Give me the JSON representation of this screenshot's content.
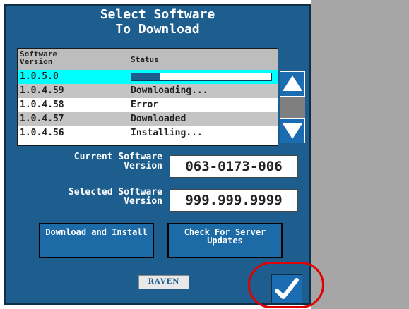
{
  "dialog": {
    "title_line1": "Select Software",
    "title_line2": "To Download"
  },
  "table": {
    "header_version": "Software Version",
    "header_status": "Status",
    "rows": [
      {
        "version": "1.0.5.0",
        "status": "",
        "progress": 0.2,
        "selected": true
      },
      {
        "version": "1.0.4.59",
        "status": "Downloading..."
      },
      {
        "version": "1.0.4.58",
        "status": "Error"
      },
      {
        "version": "1.0.4.57",
        "status": "Downloaded"
      },
      {
        "version": "1.0.4.56",
        "status": "Installing..."
      }
    ]
  },
  "current": {
    "label": "Current Software Version",
    "value": "063-0173-006"
  },
  "selected": {
    "label": "Selected Software Version",
    "value": "999.999.9999"
  },
  "buttons": {
    "download_install": "Download and Install",
    "check_updates": "Check For Server Updates"
  },
  "logo": "RAVEN",
  "icons": {
    "scroll_up": "up-arrow-icon",
    "scroll_down": "down-arrow-icon",
    "confirm": "checkmark-icon"
  },
  "colors": {
    "panel": "#1d5e8f",
    "selected_row": "#00ffff",
    "highlight": "#e00000"
  }
}
